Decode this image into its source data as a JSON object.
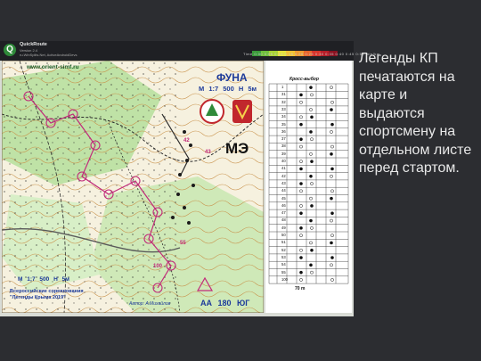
{
  "window": {
    "app_name": "QuickRoute",
    "app_subtitle_1": "Version 2.4",
    "app_subtitle_2": "ru.WinSplits.Net, ActiveAndroidDevs",
    "time_axis": "Time  0:00  0:05  0:10  0:15  0:20  0:25  0:30  0:35  0:40  0:45  0:50  min/km",
    "legend_colors": [
      "#3a9a3a",
      "#6fbf3a",
      "#a8d234",
      "#e5e23a",
      "#f1c232",
      "#ef9a2f",
      "#e8642a",
      "#d7332a",
      "#b51d28",
      "#8a1120"
    ]
  },
  "map": {
    "url": "www.orient-simf.ru",
    "title": "ФУНА",
    "scale": "М 1:7 500   Н 5м",
    "class": "МЭ",
    "scale_bottom": "М 1:7 500   Н 5м",
    "event_line1": "Всероссийские соревнования",
    "event_line2": "\"Легенды Крыма 2019\"",
    "author": "Автор: А.Михайлов",
    "course": "АА 180  ЮГ",
    "labels": [
      "42",
      "43",
      "100",
      "55"
    ]
  },
  "legend_sheet": {
    "title": "Кросс-выбор",
    "footer": "70 m",
    "rows": [
      "1",
      "31",
      "32",
      "33",
      "34",
      "35",
      "36",
      "37",
      "38",
      "39",
      "40",
      "41",
      "42",
      "43",
      "44",
      "45",
      "46",
      "47",
      "48",
      "49",
      "50",
      "51",
      "52",
      "53",
      "54",
      "55",
      "100"
    ]
  },
  "caption": {
    "text": "Легенды КП печатаются на карте и выдаются спортсмену на отдельном листе перед стартом."
  }
}
